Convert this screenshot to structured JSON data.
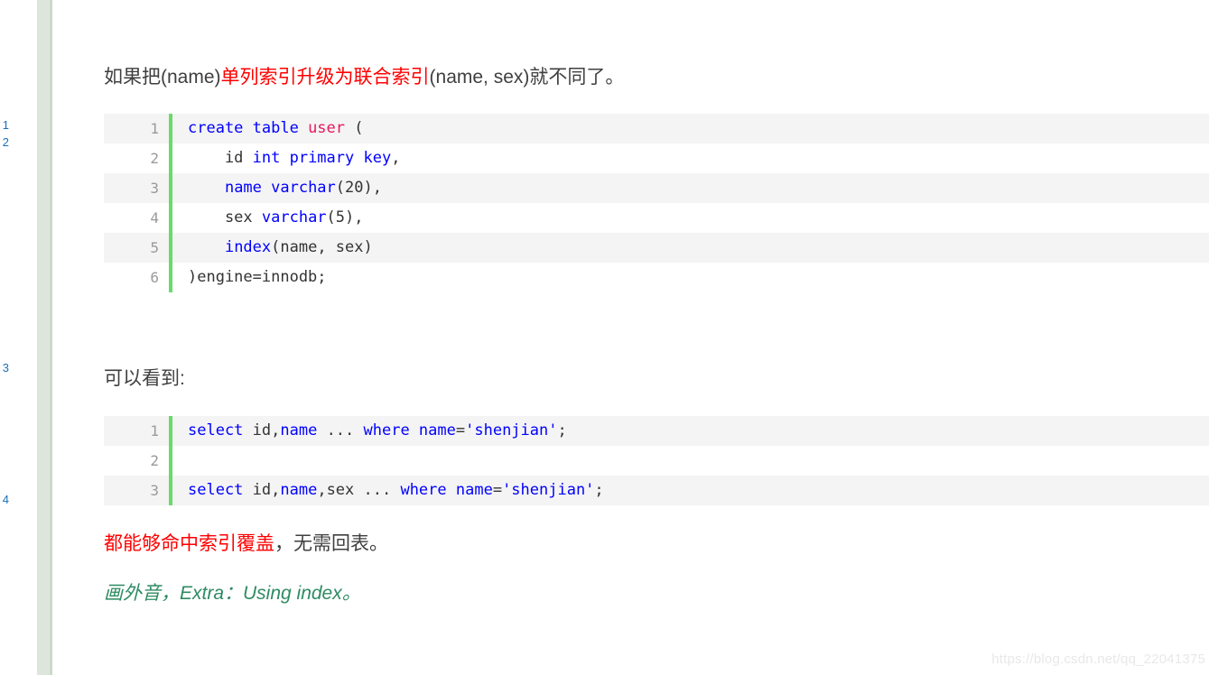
{
  "sidebar": {
    "fragments": [
      "1",
      "2",
      "3",
      "4"
    ]
  },
  "content": {
    "heading": {
      "part1": "如果把(name)",
      "part2_red": "单列索引升级为联合索引",
      "part3": "(name, sex)就不同了。"
    },
    "kanjian": "可以看到:",
    "cover": {
      "part1_red": "都能够命中索引覆盖",
      "part2": "，无需回表。"
    },
    "aside": "画外音，Extra：Using index。"
  },
  "code_block_1": {
    "lines": [
      {
        "num": "1",
        "tokens": [
          {
            "t": "create table ",
            "c": "kw"
          },
          {
            "t": "user",
            "c": "tbl"
          },
          {
            "t": " (",
            "c": "pln"
          }
        ]
      },
      {
        "num": "2",
        "tokens": [
          {
            "t": "    id ",
            "c": "pln"
          },
          {
            "t": "int primary key",
            "c": "kw"
          },
          {
            "t": ",",
            "c": "pln"
          }
        ]
      },
      {
        "num": "3",
        "tokens": [
          {
            "t": "    ",
            "c": "pln"
          },
          {
            "t": "name varchar",
            "c": "kw"
          },
          {
            "t": "(20),",
            "c": "pln"
          }
        ]
      },
      {
        "num": "4",
        "tokens": [
          {
            "t": "    sex ",
            "c": "pln"
          },
          {
            "t": "varchar",
            "c": "kw"
          },
          {
            "t": "(5),",
            "c": "pln"
          }
        ]
      },
      {
        "num": "5",
        "tokens": [
          {
            "t": "    ",
            "c": "pln"
          },
          {
            "t": "index",
            "c": "kw"
          },
          {
            "t": "(name, sex)",
            "c": "pln"
          }
        ]
      },
      {
        "num": "6",
        "tokens": [
          {
            "t": ")engine=innodb;",
            "c": "pln"
          }
        ]
      }
    ]
  },
  "code_block_2": {
    "lines": [
      {
        "num": "1",
        "tokens": [
          {
            "t": "select ",
            "c": "kw"
          },
          {
            "t": "id,",
            "c": "pln"
          },
          {
            "t": "name",
            "c": "kw"
          },
          {
            "t": " ... ",
            "c": "pln"
          },
          {
            "t": "where name",
            "c": "kw"
          },
          {
            "t": "=",
            "c": "pln"
          },
          {
            "t": "'shenjian'",
            "c": "str"
          },
          {
            "t": ";",
            "c": "pln"
          }
        ]
      },
      {
        "num": "2",
        "tokens": [
          {
            "t": "",
            "c": "pln"
          }
        ]
      },
      {
        "num": "3",
        "tokens": [
          {
            "t": "select ",
            "c": "kw"
          },
          {
            "t": "id,",
            "c": "pln"
          },
          {
            "t": "name",
            "c": "kw"
          },
          {
            "t": ",sex ... ",
            "c": "pln"
          },
          {
            "t": "where name",
            "c": "kw"
          },
          {
            "t": "=",
            "c": "pln"
          },
          {
            "t": "'shenjian'",
            "c": "str"
          },
          {
            "t": ";",
            "c": "pln"
          }
        ]
      }
    ]
  },
  "watermark": "https://blog.csdn.net/qq_22041375",
  "colors": {
    "accent_red": "#ff0000",
    "accent_green": "#2e8b62",
    "gutter_green": "#6ada6a",
    "keyword_blue": "#0000ff",
    "table_pink": "#e8185e",
    "code_alt_row": "#f4f4f4",
    "rail_band": "#dde6dd"
  }
}
